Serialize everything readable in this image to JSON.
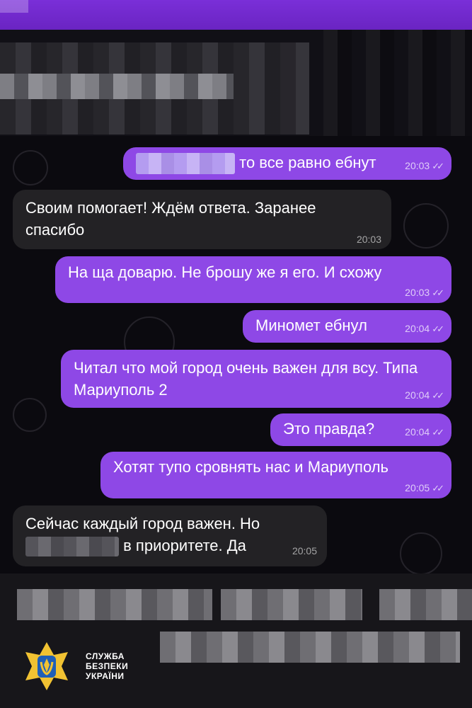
{
  "messages": [
    {
      "direction": "out",
      "text": "то все равно ебнут",
      "time": "20:03",
      "read": "✓✓"
    },
    {
      "direction": "in",
      "text": "Своим помогает! Ждём ответа. Заранее спасибо",
      "time": "20:03"
    },
    {
      "direction": "out",
      "text": "На ща доварю. Не брошу же я его. И схожу",
      "time": "20:03",
      "read": "✓✓"
    },
    {
      "direction": "out",
      "text": "Миномет ебнул",
      "time": "20:04",
      "read": "✓✓"
    },
    {
      "direction": "out",
      "text": "Читал что мой город очень важен для всу. Типа Мариуполь 2",
      "time": "20:04",
      "read": "✓✓"
    },
    {
      "direction": "out",
      "text": "Это правда?",
      "time": "20:04",
      "read": "✓✓"
    },
    {
      "direction": "out",
      "text": "Хотят тупо сровнять нас и Мариуполь",
      "time": "20:05",
      "read": "✓✓"
    },
    {
      "direction": "in",
      "text_line1": "Сейчас каждый город важен. Но",
      "text_line2": "в приоритете. Да",
      "time": "20:05"
    }
  ],
  "watermark": {
    "line1": "СЛУЖБА",
    "line2": "БЕЗПЕКИ",
    "line3": "УКРАЇНИ"
  },
  "colors": {
    "top_bar": "#7a2fd8",
    "outgoing_bubble": "#8e48e6",
    "incoming_bubble": "#232225",
    "background": "#0b0a0f",
    "shield_blue": "#1f5fb7",
    "shield_gold": "#f1c232"
  }
}
